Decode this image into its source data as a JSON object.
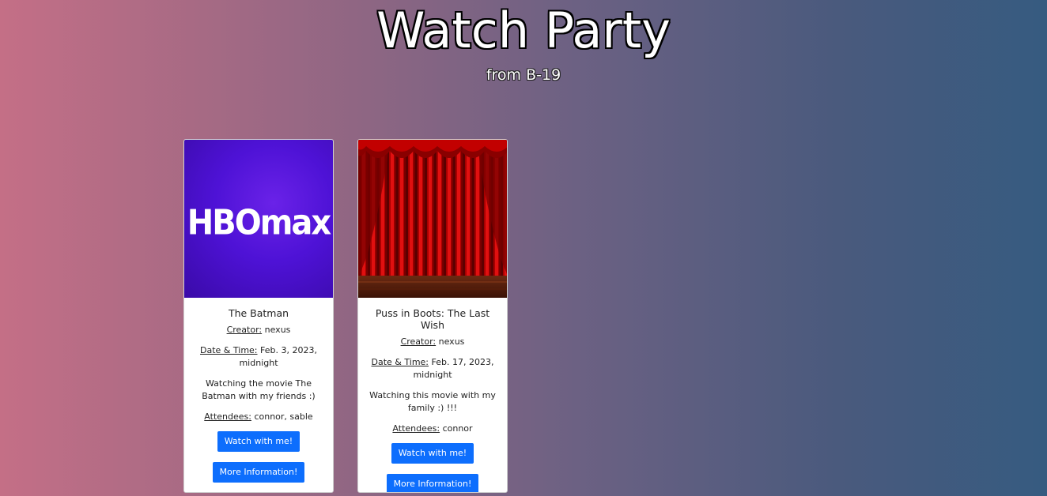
{
  "header": {
    "title": "Watch Party",
    "subtitle": "from B-19"
  },
  "colors": {
    "button": "#0d6efd",
    "gradient_left": "#c46f86",
    "gradient_right": "#365b80",
    "hbo_purple": "#4e12d6",
    "curtain_red": "#b30000"
  },
  "cards": [
    {
      "image": "hbo-max-logo",
      "image_text": "HBOmax",
      "title": "The Batman",
      "creator_label": "Creator:",
      "creator": "nexus",
      "datetime_label": "Date & Time:",
      "datetime": "Feb. 3, 2023, midnight",
      "description": "Watching the movie The Batman with my friends :)",
      "attendees_label": "Attendees:",
      "attendees": "connor, sable",
      "watch_button": "Watch with me!",
      "info_button": "More Information!"
    },
    {
      "image": "red-theater-curtain",
      "title": "Puss in Boots: The Last Wish",
      "creator_label": "Creator:",
      "creator": "nexus",
      "datetime_label": "Date & Time:",
      "datetime": "Feb. 17, 2023, midnight",
      "description": "Watching this movie with my family :) !!!",
      "attendees_label": "Attendees:",
      "attendees": "connor",
      "watch_button": "Watch with me!",
      "info_button": "More Information!"
    }
  ]
}
